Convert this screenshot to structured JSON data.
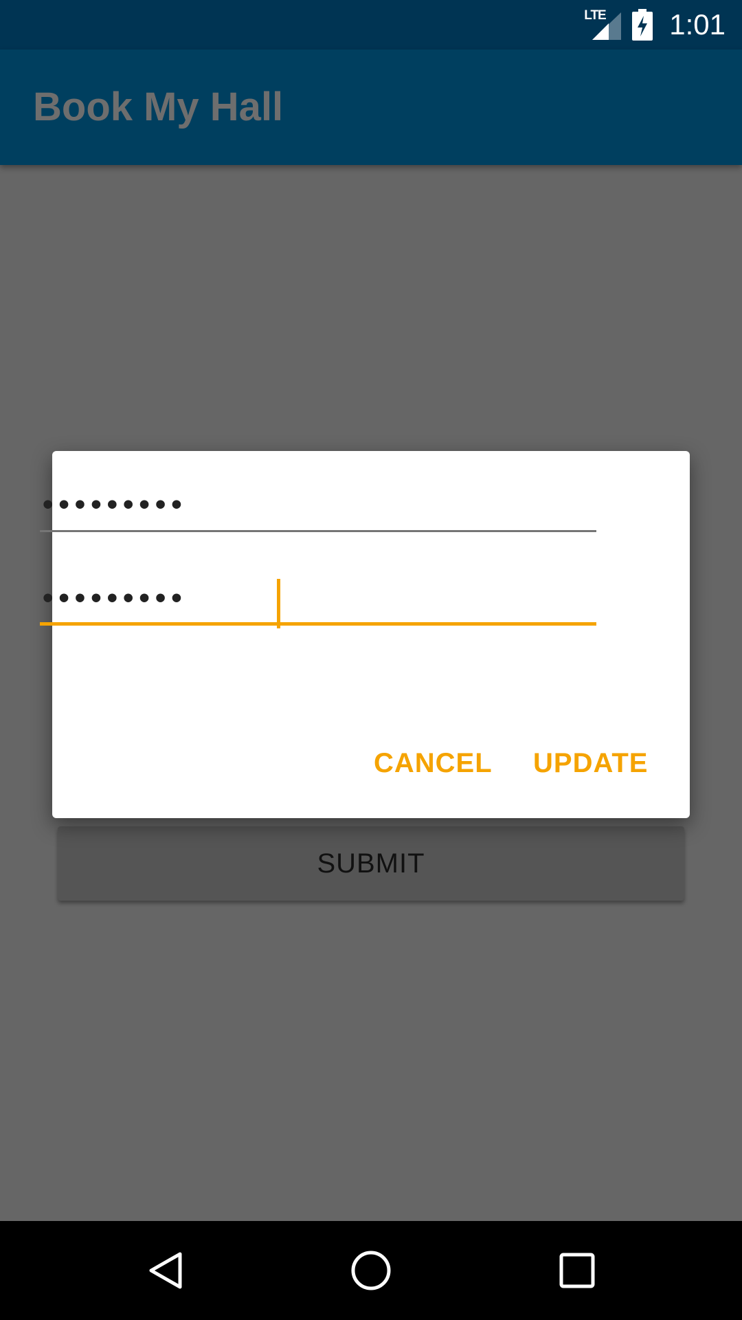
{
  "status_bar": {
    "network_label": "LTE",
    "time": "1:01",
    "icons": [
      "lte-signal-icon",
      "battery-charging-icon"
    ]
  },
  "app_bar": {
    "title": "Book My Hall"
  },
  "dialog": {
    "field1": {
      "value": "•••••••••"
    },
    "field2": {
      "value": "•••••••••"
    },
    "cancel_label": "CANCEL",
    "update_label": "UPDATE"
  },
  "main": {
    "submit_label": "SUBMIT"
  },
  "nav_bar": {
    "icons": [
      "back-icon",
      "home-icon",
      "recents-icon"
    ]
  },
  "colors": {
    "accent": "#f5a300",
    "app_bar": "#003f5f",
    "status_bar": "#003453",
    "scrim_background": "#666666"
  }
}
